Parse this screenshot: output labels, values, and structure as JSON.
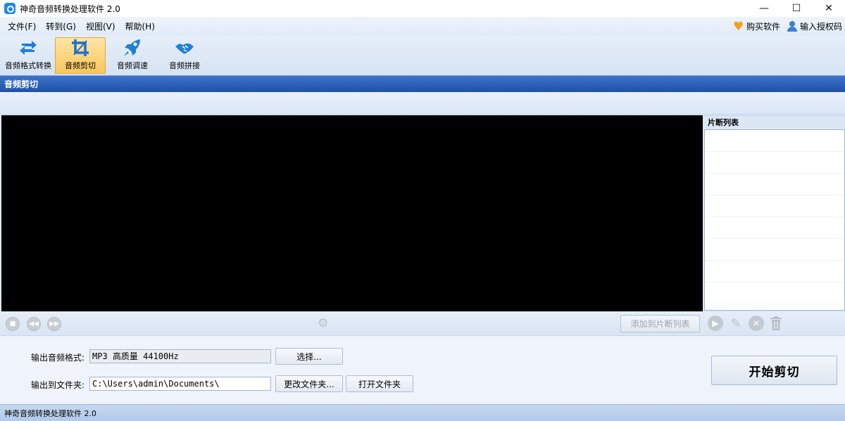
{
  "window": {
    "title": "神奇音频转换处理软件 2.0",
    "controls": {
      "minimize": "—",
      "maximize": "☐",
      "close": "✕"
    }
  },
  "menu": {
    "items": [
      {
        "label": "文件(F)"
      },
      {
        "label": "转到(G)"
      },
      {
        "label": "视图(V)"
      },
      {
        "label": "帮助(H)"
      }
    ],
    "buy": "购买软件",
    "license": "输入授权码"
  },
  "toolbar": {
    "tools": [
      {
        "label": "音频格式转换",
        "icon": "convert-icon",
        "active": false
      },
      {
        "label": "音频剪切",
        "icon": "crop-icon",
        "active": true
      },
      {
        "label": "音频调速",
        "icon": "rocket-icon",
        "active": false
      },
      {
        "label": "音频拼接",
        "icon": "handshake-icon",
        "active": false
      }
    ]
  },
  "section": {
    "title": "音频剪切"
  },
  "clip_list": {
    "title": "片断列表",
    "rows": 8
  },
  "controls": {
    "add_to_list": "添加到片断列表"
  },
  "output": {
    "format_label": "输出音频格式:",
    "format_value": "MP3 高质量 44100Hz",
    "select_button": "选择...",
    "folder_label": "输出到文件夹:",
    "folder_value": "C:\\Users\\admin\\Documents\\",
    "change_folder_button": "更改文件夹...",
    "open_folder_button": "打开文件夹",
    "start_button": "开始剪切"
  },
  "status": {
    "text": "神奇音频转换处理软件 2.0"
  },
  "colors": {
    "accent_header": "#1f52a8",
    "active_tool": "#f8c65a",
    "icon_blue": "#1e7fd8"
  }
}
